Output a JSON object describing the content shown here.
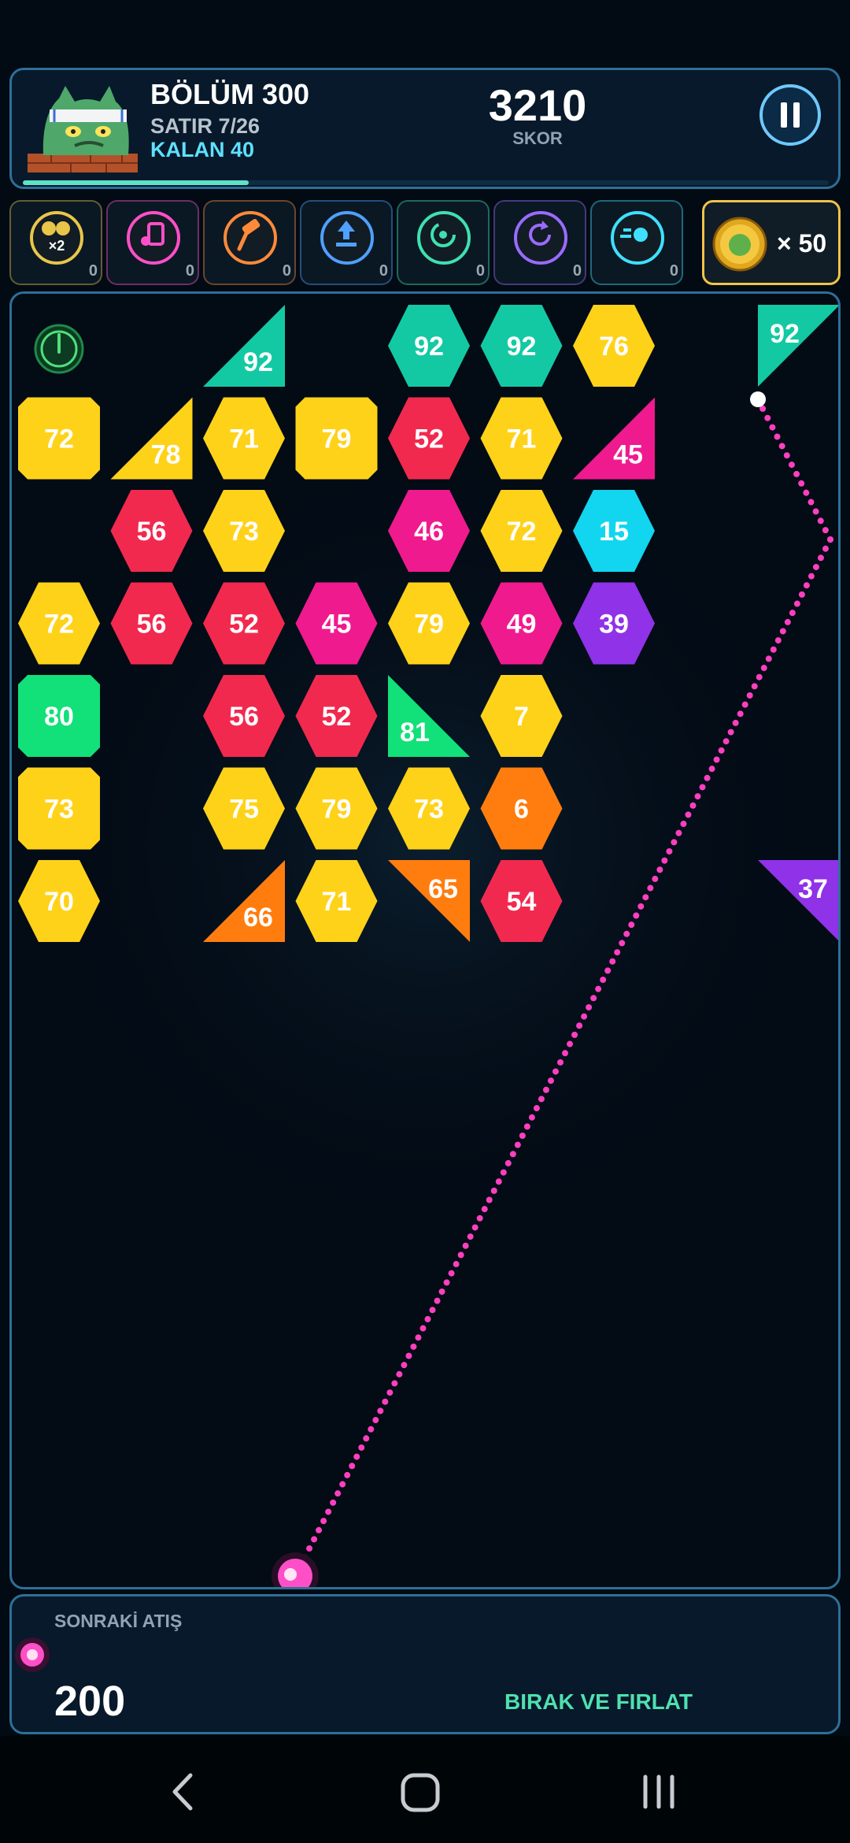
{
  "header": {
    "level_title": "BÖLÜM 300",
    "row_text": "SATIR 7/26",
    "remaining_text": "KALAN 40",
    "score_value": "3210",
    "score_label": "SKOR",
    "level_progress": 0.28
  },
  "powerups": [
    {
      "icon": "double-ball-icon",
      "badge": "×2",
      "count": "0",
      "color": "#e8c64a"
    },
    {
      "icon": "music-box-icon",
      "count": "0",
      "color": "#ff4fc8"
    },
    {
      "icon": "hammer-icon",
      "count": "0",
      "color": "#ff8a3a"
    },
    {
      "icon": "upload-icon",
      "count": "0",
      "color": "#4fa0ff"
    },
    {
      "icon": "spin-icon",
      "count": "0",
      "color": "#3fe0b0"
    },
    {
      "icon": "refresh-icon",
      "count": "0",
      "color": "#9a6bff"
    },
    {
      "icon": "speed-icon",
      "count": "0",
      "color": "#3fe0ff"
    }
  ],
  "coins": {
    "count": "× 50",
    "icon": "coin-icon"
  },
  "colors": {
    "yellow": "#ffd21a",
    "red": "#f2294f",
    "magenta": "#f01a8f",
    "teal": "#13c9a3",
    "cyan": "#12d6ef",
    "purple": "#8f32e8",
    "green": "#12e079",
    "orange": "#ff7d0f",
    "aim_line": "#ff3fbf"
  },
  "blocks": [
    {
      "row": 0,
      "col": 2,
      "shape": "tri-br",
      "color": "teal",
      "value": "92"
    },
    {
      "row": 0,
      "col": 4,
      "shape": "hex",
      "color": "teal",
      "value": "92"
    },
    {
      "row": 0,
      "col": 5,
      "shape": "hex",
      "color": "teal",
      "value": "92"
    },
    {
      "row": 0,
      "col": 6,
      "shape": "hex",
      "color": "yellow",
      "value": "76"
    },
    {
      "row": 0,
      "col": 8,
      "shape": "tri-tl",
      "color": "teal",
      "value": "92"
    },
    {
      "row": 1,
      "col": 0,
      "shape": "oct",
      "color": "yellow",
      "value": "72"
    },
    {
      "row": 1,
      "col": 1,
      "shape": "tri-br",
      "color": "yellow",
      "value": "78"
    },
    {
      "row": 1,
      "col": 2,
      "shape": "hex",
      "color": "yellow",
      "value": "71"
    },
    {
      "row": 1,
      "col": 3,
      "shape": "oct",
      "color": "yellow",
      "value": "79"
    },
    {
      "row": 1,
      "col": 4,
      "shape": "hex",
      "color": "red",
      "value": "52"
    },
    {
      "row": 1,
      "col": 5,
      "shape": "hex",
      "color": "yellow",
      "value": "71"
    },
    {
      "row": 1,
      "col": 6,
      "shape": "tri-br",
      "color": "magenta",
      "value": "45"
    },
    {
      "row": 2,
      "col": 1,
      "shape": "hex",
      "color": "red",
      "value": "56"
    },
    {
      "row": 2,
      "col": 2,
      "shape": "hex",
      "color": "yellow",
      "value": "73"
    },
    {
      "row": 2,
      "col": 4,
      "shape": "hex",
      "color": "magenta",
      "value": "46"
    },
    {
      "row": 2,
      "col": 5,
      "shape": "hex",
      "color": "yellow",
      "value": "72"
    },
    {
      "row": 2,
      "col": 6,
      "shape": "hex",
      "color": "cyan",
      "value": "15"
    },
    {
      "row": 3,
      "col": 0,
      "shape": "hex",
      "color": "yellow",
      "value": "72"
    },
    {
      "row": 3,
      "col": 1,
      "shape": "hex",
      "color": "red",
      "value": "56"
    },
    {
      "row": 3,
      "col": 2,
      "shape": "hex",
      "color": "red",
      "value": "52"
    },
    {
      "row": 3,
      "col": 3,
      "shape": "hex",
      "color": "magenta",
      "value": "45"
    },
    {
      "row": 3,
      "col": 4,
      "shape": "hex",
      "color": "yellow",
      "value": "79"
    },
    {
      "row": 3,
      "col": 5,
      "shape": "hex",
      "color": "magenta",
      "value": "49"
    },
    {
      "row": 3,
      "col": 6,
      "shape": "hex",
      "color": "purple",
      "value": "39"
    },
    {
      "row": 4,
      "col": 0,
      "shape": "oct",
      "color": "green",
      "value": "80"
    },
    {
      "row": 4,
      "col": 2,
      "shape": "hex",
      "color": "red",
      "value": "56"
    },
    {
      "row": 4,
      "col": 3,
      "shape": "hex",
      "color": "red",
      "value": "52"
    },
    {
      "row": 4,
      "col": 4,
      "shape": "tri-bl",
      "color": "green",
      "value": "81"
    },
    {
      "row": 4,
      "col": 5,
      "shape": "hex",
      "color": "yellow",
      "value": "7"
    },
    {
      "row": 5,
      "col": 0,
      "shape": "oct",
      "color": "yellow",
      "value": "73"
    },
    {
      "row": 5,
      "col": 2,
      "shape": "hex",
      "color": "yellow",
      "value": "75"
    },
    {
      "row": 5,
      "col": 3,
      "shape": "hex",
      "color": "yellow",
      "value": "79"
    },
    {
      "row": 5,
      "col": 4,
      "shape": "hex",
      "color": "yellow",
      "value": "73"
    },
    {
      "row": 5,
      "col": 5,
      "shape": "hex",
      "color": "orange",
      "value": "6"
    },
    {
      "row": 6,
      "col": 0,
      "shape": "hex",
      "color": "yellow",
      "value": "70"
    },
    {
      "row": 6,
      "col": 2,
      "shape": "tri-br",
      "color": "orange",
      "value": "66"
    },
    {
      "row": 6,
      "col": 3,
      "shape": "hex",
      "color": "yellow",
      "value": "71"
    },
    {
      "row": 6,
      "col": 4,
      "shape": "tri-tr",
      "color": "orange",
      "value": "65"
    },
    {
      "row": 6,
      "col": 5,
      "shape": "hex",
      "color": "red",
      "value": "54"
    },
    {
      "row": 6,
      "col": 8,
      "shape": "tri-tr",
      "color": "purple",
      "value": "37"
    }
  ],
  "bottom": {
    "next_label": "SONRAKİ ATIŞ",
    "ball_count": "200",
    "release_label": "BIRAK VE FIRLAT"
  },
  "navbar": {
    "back": "back-icon",
    "home": "home-icon",
    "recents": "recents-icon"
  }
}
